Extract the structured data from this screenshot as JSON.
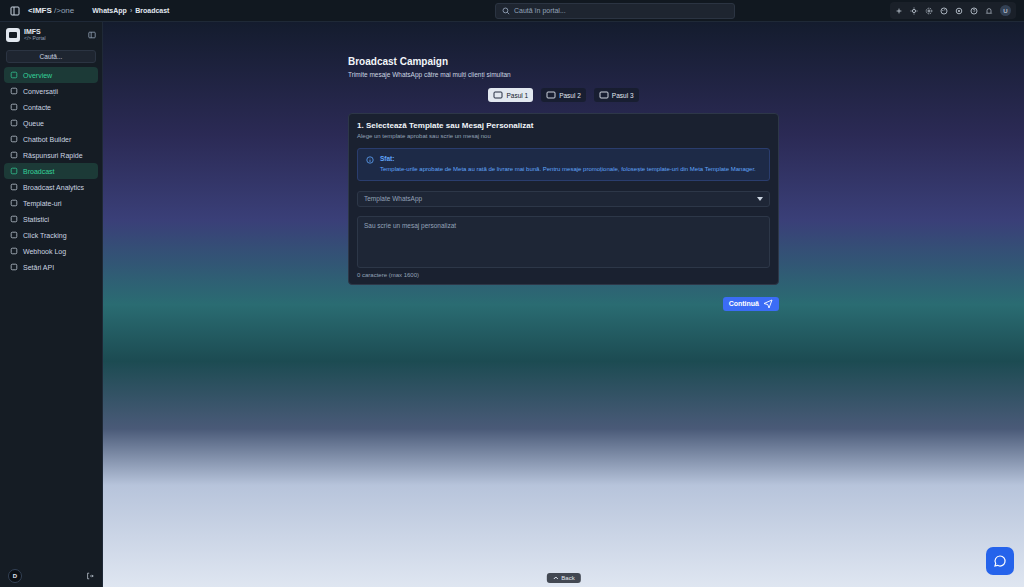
{
  "topbar": {
    "logo_main": "<IMFS",
    "logo_suffix": "/>one",
    "breadcrumb": [
      "WhatsApp",
      "Broadcast"
    ],
    "breadcrumb_separator": "›",
    "search": {
      "placeholder": "Caută în portal..."
    },
    "user_avatar": "U"
  },
  "sidebar": {
    "brand": "IMFS",
    "brand_sub": "</> Portal",
    "search": {
      "placeholder": "Caută..."
    },
    "items": [
      {
        "label": "Overview",
        "selected": true
      },
      {
        "label": "Conversații",
        "selected": false
      },
      {
        "label": "Contacte",
        "selected": false
      },
      {
        "label": "Queue",
        "selected": false
      },
      {
        "label": "Chatbot Builder",
        "selected": false
      },
      {
        "label": "Răspunsuri Rapide",
        "selected": false
      },
      {
        "label": "Broadcast",
        "selected": true
      },
      {
        "label": "Broadcast Analytics",
        "selected": false
      },
      {
        "label": "Template-uri",
        "selected": false
      },
      {
        "label": "Statistici",
        "selected": false
      },
      {
        "label": "Click Tracking",
        "selected": false
      },
      {
        "label": "Webhook Log",
        "selected": false
      },
      {
        "label": "Setări API",
        "selected": false
      }
    ],
    "footer_avatar": "D"
  },
  "page": {
    "title": "Broadcast Campaign",
    "subtitle": "Trimite mesaje WhatsApp către mai mulți clienți simultan",
    "steps": [
      {
        "label": "Pasul 1",
        "selected": true
      },
      {
        "label": "Pasul 2",
        "selected": false
      },
      {
        "label": "Pasul 3",
        "selected": false
      }
    ],
    "card": {
      "title": "1. Selectează Template sau Mesaj Personalizat",
      "subtitle": "Alege un template aprobat sau scrie un mesaj nou",
      "tip_title": "Sfat:",
      "tip_text": "Template-urile aprobate de Meta au rată de livrare mai bună. Pentru mesaje promoționale, folosește template-uri din Meta Template Manager.",
      "select": {
        "placeholder": "Template WhatsApp"
      },
      "message": {
        "placeholder": "Sau scrie un mesaj personalizat"
      },
      "counter": "0 caractere (max 1600)"
    },
    "continue_button": "Continuă",
    "back_button": "Back"
  }
}
